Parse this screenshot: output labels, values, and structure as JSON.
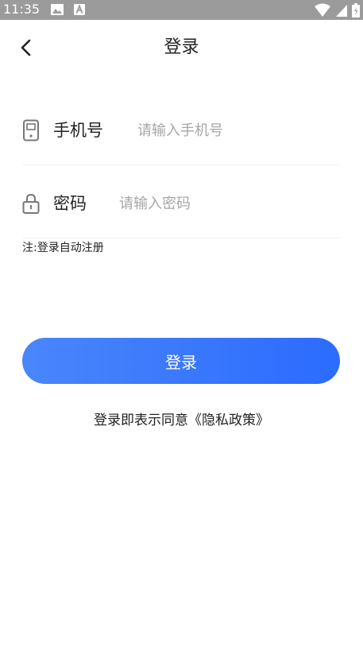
{
  "status_bar": {
    "time": "11:35",
    "left_icons": [
      "image-icon",
      "a-icon"
    ],
    "right_icons": [
      "wifi-icon",
      "signal-icon",
      "battery-icon"
    ],
    "background": "#9b9b9b"
  },
  "nav": {
    "back_icon": "chevron-left-icon",
    "title": "登录"
  },
  "form": {
    "phone": {
      "icon": "phone-icon",
      "label": "手机号",
      "value": "",
      "placeholder": "请输入手机号"
    },
    "password": {
      "icon": "lock-icon",
      "label": "密码",
      "value": "",
      "placeholder": "请输入密码"
    },
    "note": "注:登录自动注册"
  },
  "login_button": {
    "label": "登录",
    "color": "#2b6bff"
  },
  "agreement": {
    "prefix": "登录即表示同意",
    "link": "《隐私政策》"
  }
}
